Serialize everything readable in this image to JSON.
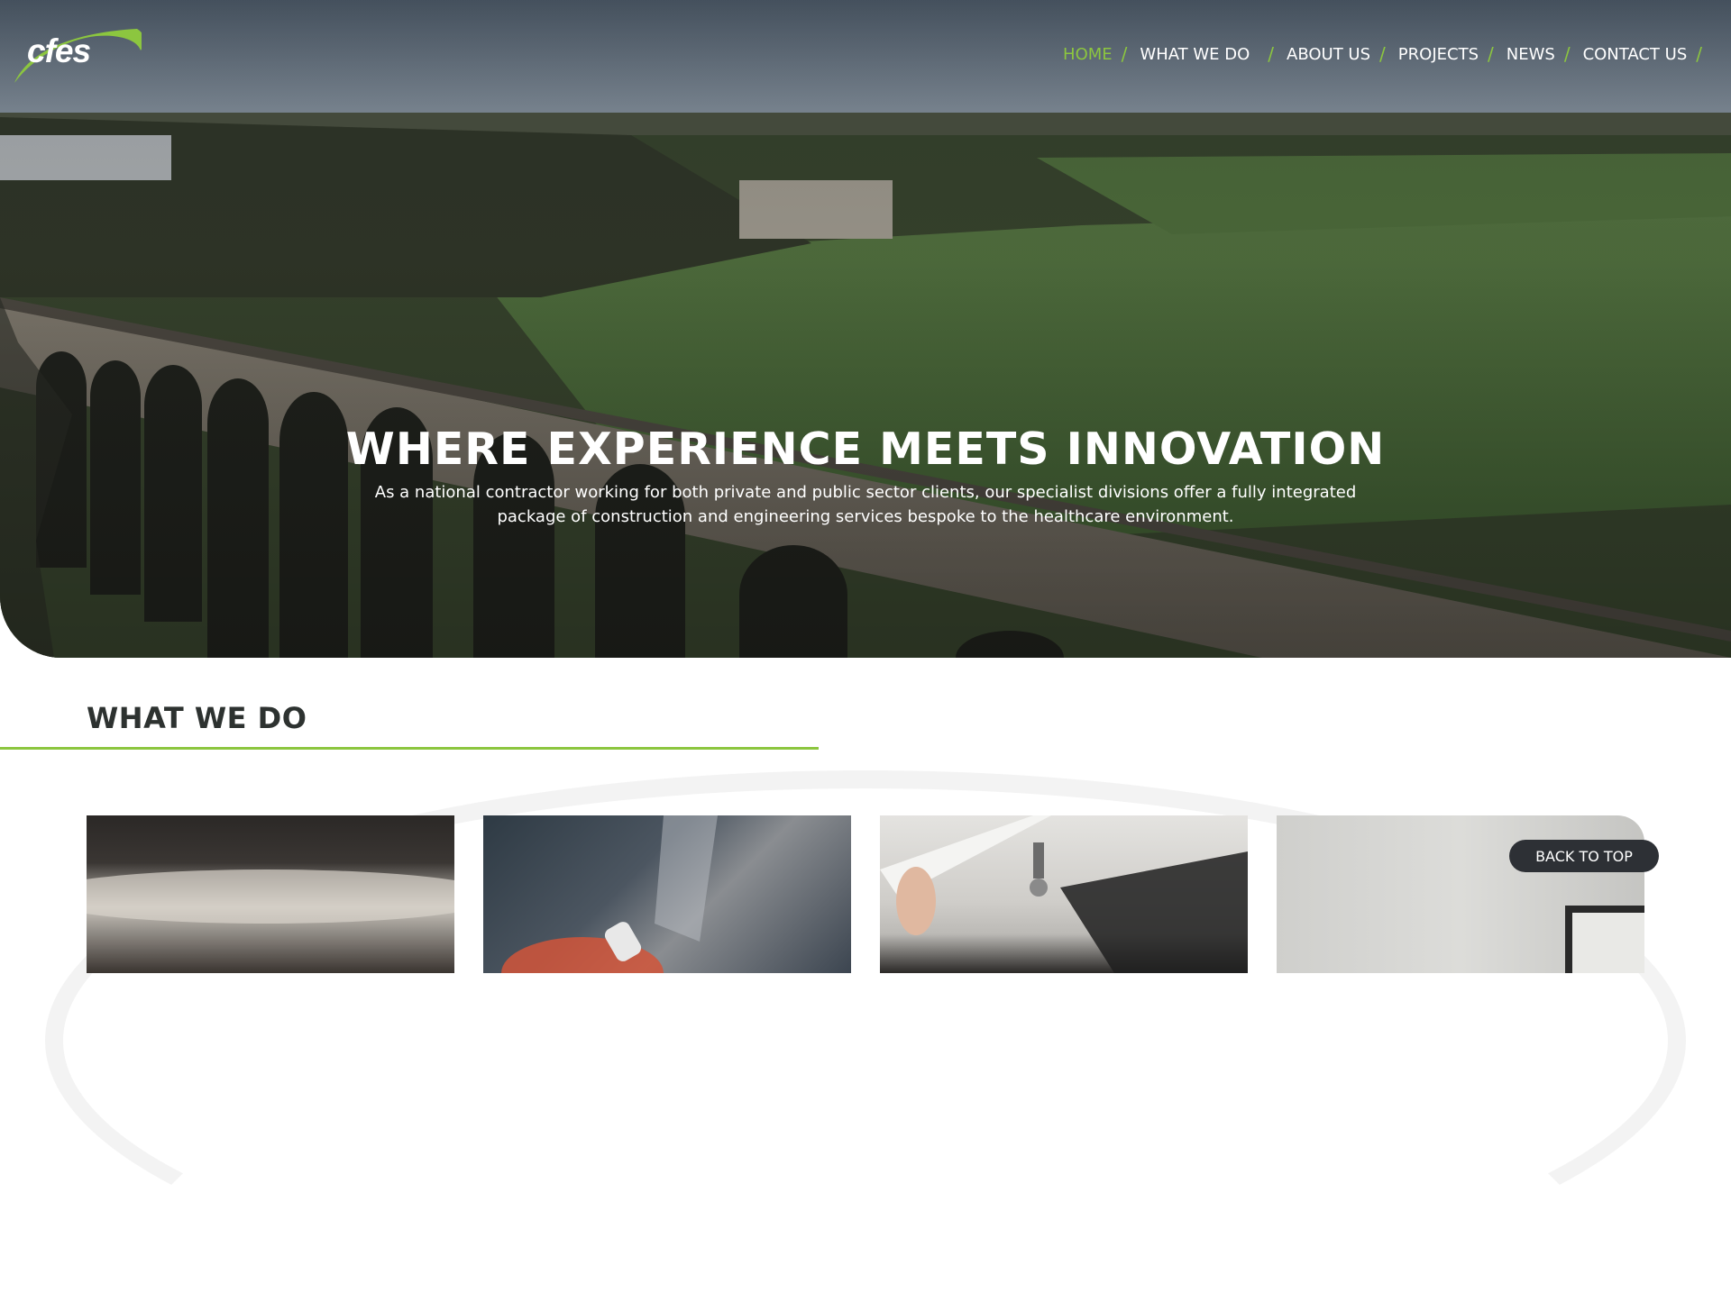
{
  "brand": {
    "logo_text": "cfes",
    "accent_color": "#8cc63f"
  },
  "nav": {
    "items": [
      {
        "label": "HOME",
        "active": true
      },
      {
        "label": "WHAT WE DO",
        "active": false
      },
      {
        "label": "ABOUT US",
        "active": false
      },
      {
        "label": "PROJECTS",
        "active": false
      },
      {
        "label": "NEWS",
        "active": false
      },
      {
        "label": "CONTACT US",
        "active": false
      }
    ],
    "separator": "/"
  },
  "hero": {
    "title": "WHERE EXPERIENCE MEETS INNOVATION",
    "subtitle": "As a national contractor working for both private and public sector clients, our specialist divisions offer a fully integrated package of construction and engineering services bespoke to the healthcare environment.",
    "image_description_icon": "landscape-viaduct-image"
  },
  "what_we_do": {
    "title": "WHAT WE DO",
    "cards": [
      {
        "image": "blurred-material-image"
      },
      {
        "image": "hands-tools-image"
      },
      {
        "image": "ceiling-sprinkler-image"
      },
      {
        "image": "office-wall-monitor-image"
      }
    ]
  },
  "back_to_top": {
    "label": "BACK TO TOP"
  }
}
